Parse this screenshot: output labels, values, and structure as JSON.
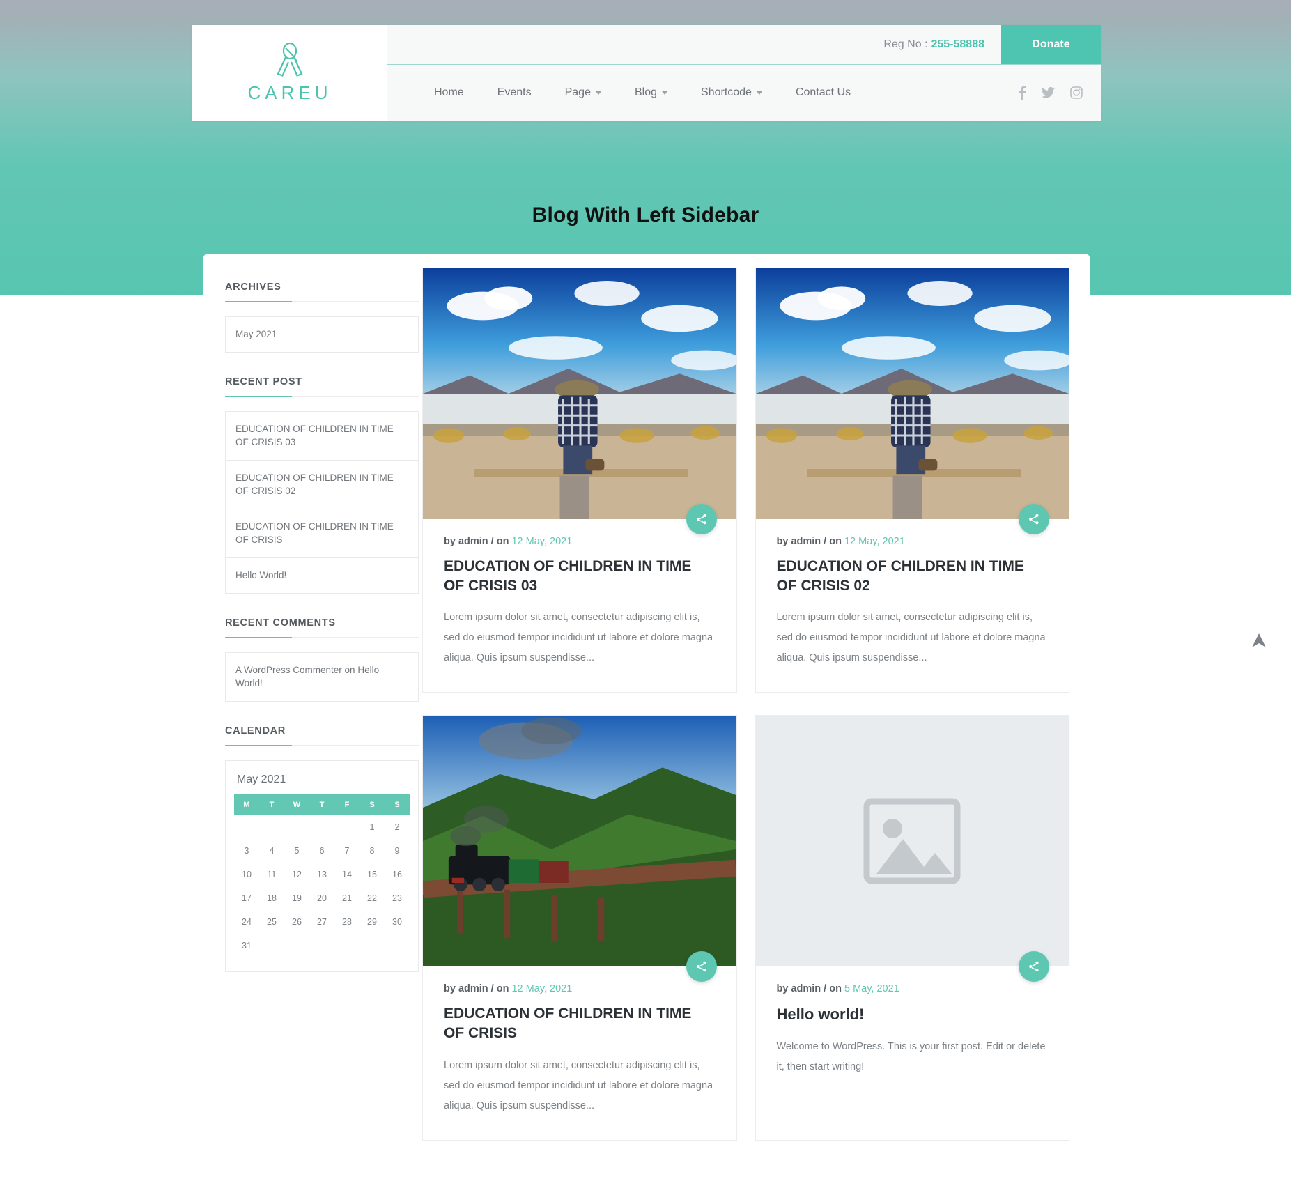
{
  "header": {
    "logo_text": "CAREU",
    "logo_icon": "ribbon-icon",
    "regno_label": "Reg No :",
    "regno_value": "255-58888",
    "donate_label": "Donate",
    "nav": [
      {
        "label": "Home",
        "has_dropdown": false
      },
      {
        "label": "Events",
        "has_dropdown": false
      },
      {
        "label": "Page",
        "has_dropdown": true
      },
      {
        "label": "Blog",
        "has_dropdown": true
      },
      {
        "label": "Shortcode",
        "has_dropdown": true
      },
      {
        "label": "Contact Us",
        "has_dropdown": false
      }
    ],
    "social": [
      "facebook-icon",
      "twitter-icon",
      "instagram-icon"
    ]
  },
  "hero": {
    "title": "Blog With Left Sidebar"
  },
  "sidebar": {
    "archives": {
      "title": "ARCHIVES",
      "items": [
        "May 2021"
      ]
    },
    "recent_post": {
      "title": "RECENT POST",
      "items": [
        "EDUCATION OF CHILDREN IN TIME OF CRISIS 03",
        "EDUCATION OF CHILDREN IN TIME OF CRISIS 02",
        "EDUCATION OF CHILDREN IN TIME OF CRISIS",
        "Hello World!"
      ]
    },
    "recent_comments": {
      "title": "RECENT COMMENTS",
      "items": [
        "A WordPress Commenter on Hello World!"
      ]
    },
    "calendar": {
      "title": "CALENDAR",
      "caption": "May 2021",
      "weekdays": [
        "M",
        "T",
        "W",
        "T",
        "F",
        "S",
        "S"
      ],
      "weeks": [
        [
          "",
          "",
          "",
          "",
          "",
          "1",
          "2"
        ],
        [
          "3",
          "4",
          "5",
          "6",
          "7",
          "8",
          "9"
        ],
        [
          "10",
          "11",
          "12",
          "13",
          "14",
          "15",
          "16"
        ],
        [
          "17",
          "18",
          "19",
          "20",
          "21",
          "22",
          "23"
        ],
        [
          "24",
          "25",
          "26",
          "27",
          "28",
          "29",
          "30"
        ],
        [
          "31",
          "",
          "",
          "",
          "",
          "",
          ""
        ]
      ]
    }
  },
  "posts": [
    {
      "thumb": "desert-traveler-photo",
      "meta_author": "by admin / on",
      "date": "12 May, 2021",
      "title": "EDUCATION OF CHILDREN IN TIME OF CRISIS 03",
      "excerpt": "Lorem ipsum dolor sit amet, consectetur adipiscing elit is, sed do eiusmod tempor incididunt ut labore et dolore magna aliqua. Quis ipsum suspendisse...",
      "share": "share-icon"
    },
    {
      "thumb": "desert-traveler-photo",
      "meta_author": "by admin / on",
      "date": "12 May, 2021",
      "title": "EDUCATION OF CHILDREN IN TIME OF CRISIS 02",
      "excerpt": "Lorem ipsum dolor sit amet, consectetur adipiscing elit is, sed do eiusmod tempor incididunt ut labore et dolore magna aliqua. Quis ipsum suspendisse...",
      "share": "share-icon"
    },
    {
      "thumb": "steam-train-photo",
      "meta_author": "by admin / on",
      "date": "12 May, 2021",
      "title": "EDUCATION OF CHILDREN IN TIME OF CRISIS",
      "excerpt": "Lorem ipsum dolor sit amet, consectetur adipiscing elit is, sed do eiusmod tempor incididunt ut labore et dolore magna aliqua. Quis ipsum suspendisse...",
      "share": "share-icon"
    },
    {
      "thumb": "image-placeholder",
      "meta_author": "by admin / on",
      "date": "5 May, 2021",
      "title": "Hello world!",
      "excerpt": "Welcome to WordPress. This is your first post. Edit or delete it, then start writing!",
      "share": "share-icon"
    }
  ],
  "scroll_top": {
    "icon": "arrow-up-icon"
  },
  "colors": {
    "accent": "#4ec5b0",
    "hero_top": "#a8aeb8",
    "hero_bottom": "#57c6b0",
    "text_dark": "#2c3136",
    "text_muted": "#7c8186"
  }
}
